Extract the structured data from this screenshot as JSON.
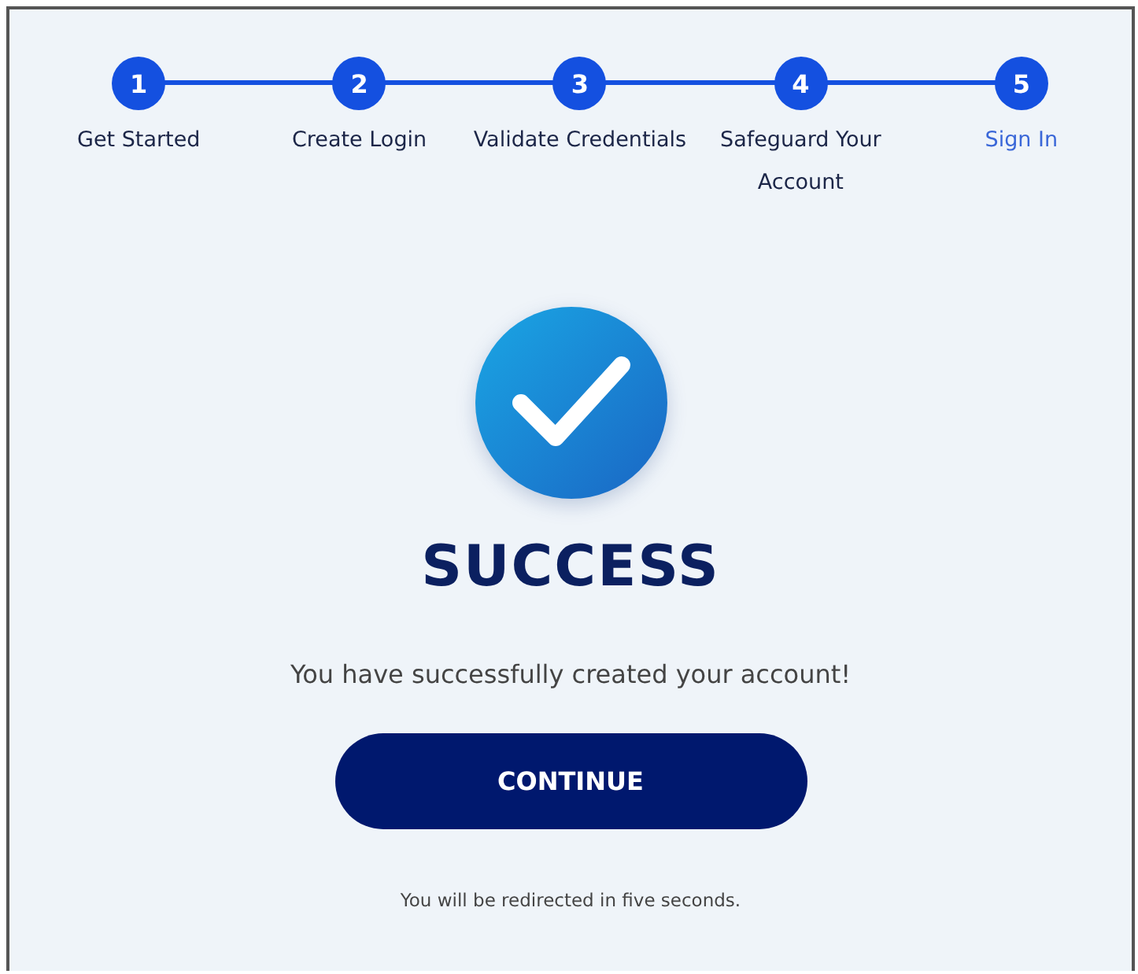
{
  "steps": [
    {
      "number": "1",
      "label": "Get Started",
      "selected": false
    },
    {
      "number": "2",
      "label": "Create Login",
      "selected": false
    },
    {
      "number": "3",
      "label": "Validate Credentials",
      "selected": false
    },
    {
      "number": "4",
      "label": "Safeguard Your Account",
      "selected": false
    },
    {
      "number": "5",
      "label": "Sign In",
      "selected": true
    }
  ],
  "title": "SUCCESS",
  "message": "You have successfully created your account!",
  "button": "CONTINUE",
  "footer": "You will be redirected in five seconds."
}
